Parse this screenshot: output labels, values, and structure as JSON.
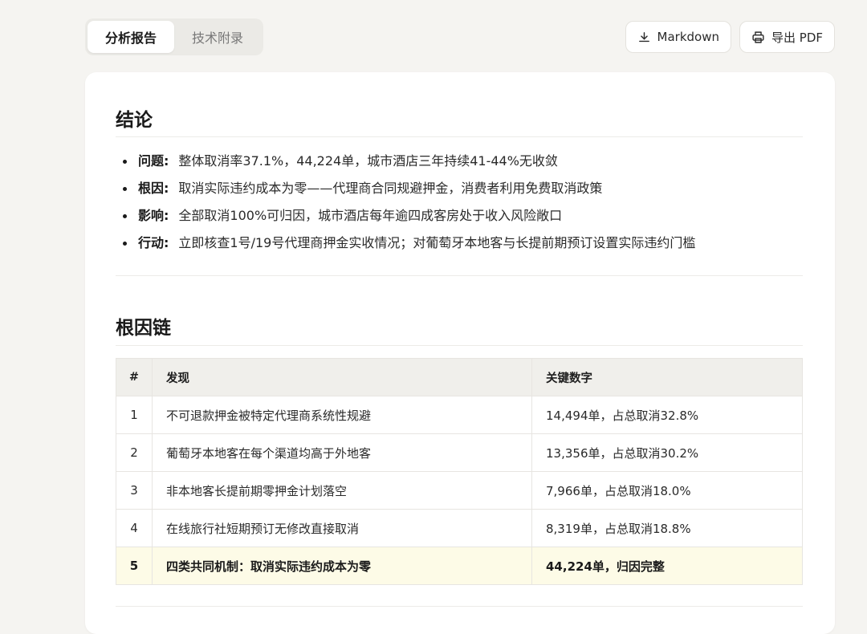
{
  "tabs": [
    {
      "label": "分析报告",
      "active": true
    },
    {
      "label": "技术附录",
      "active": false
    }
  ],
  "actions": {
    "markdown_label": "Markdown",
    "pdf_label": "导出 PDF"
  },
  "conclusion": {
    "title": "结论",
    "items": [
      {
        "label": "问题:",
        "text": "整体取消率37.1%，44,224单，城市酒店三年持续41-44%无收敛"
      },
      {
        "label": "根因:",
        "text": "取消实际违约成本为零——代理商合同规避押金，消费者利用免费取消政策"
      },
      {
        "label": "影响:",
        "text": "全部取消100%可归因，城市酒店每年逾四成客房处于收入风险敞口"
      },
      {
        "label": "行动:",
        "text": "立即核查1号/19号代理商押金实收情况；对葡萄牙本地客与长提前期预订设置实际违约门槛"
      }
    ]
  },
  "chain": {
    "title": "根因链",
    "headers": [
      "#",
      "发现",
      "关键数字"
    ],
    "rows": [
      {
        "num": "1",
        "finding": "不可退款押金被特定代理商系统性规避",
        "figure": "14,494单，占总取消32.8%"
      },
      {
        "num": "2",
        "finding": "葡萄牙本地客在每个渠道均高于外地客",
        "figure": "13,356单，占总取消30.2%"
      },
      {
        "num": "3",
        "finding": "非本地客长提前期零押金计划落空",
        "figure": "7,966单，占总取消18.0%"
      },
      {
        "num": "4",
        "finding": "在线旅行社短期预订无修改直接取消",
        "figure": "8,319单，占总取消18.8%"
      },
      {
        "num": "5",
        "finding": "四类共同机制：取消实际违约成本为零",
        "figure": "44,224单，归因完整"
      }
    ]
  },
  "colors": {
    "page_bg": "#f5f4f1",
    "card_bg": "#ffffff",
    "table_header_bg": "#f0efeb",
    "highlight_row_bg": "#fdfbe7"
  }
}
